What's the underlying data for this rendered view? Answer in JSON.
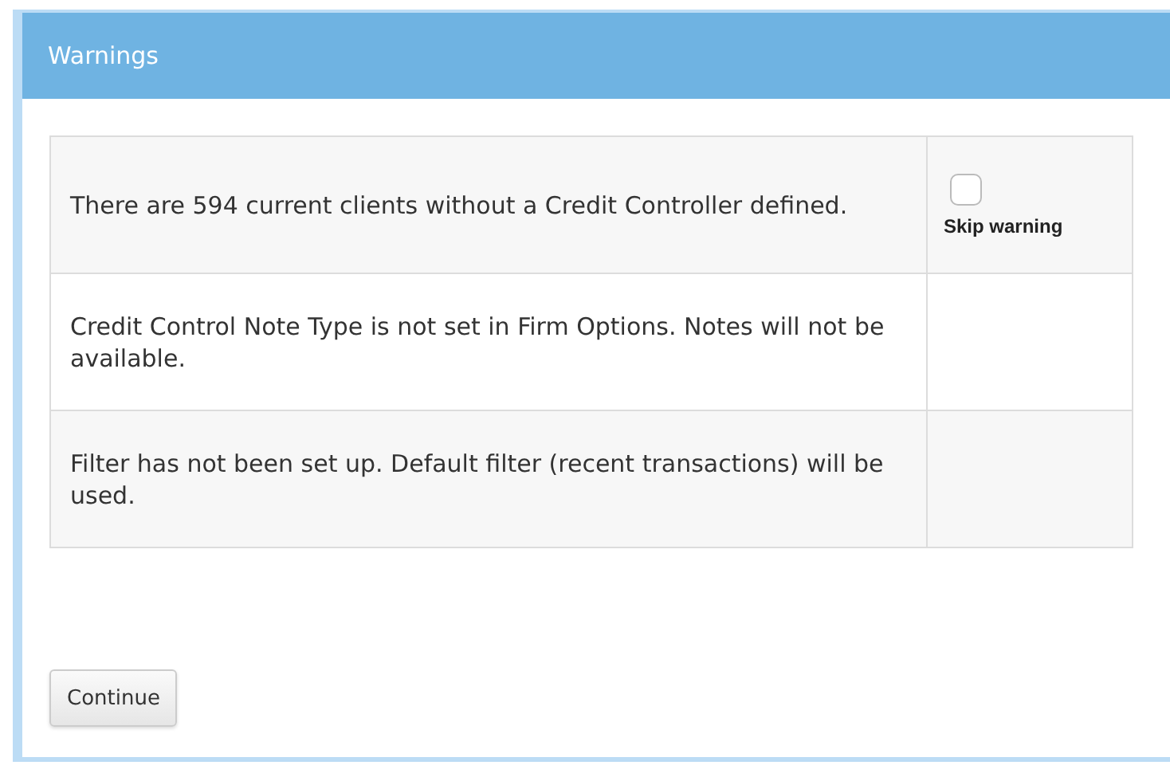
{
  "dialog": {
    "title": "Warnings"
  },
  "warnings": [
    {
      "message": "There are 594 current clients without a Credit Controller defined.",
      "skip": {
        "checked": false,
        "label": "Skip warning"
      }
    },
    {
      "message": "Credit Control Note Type is not set in Firm Options. Notes will not be available."
    },
    {
      "message": "Filter has not been set up. Default filter (recent transactions) will be used."
    }
  ],
  "buttons": [
    "Continue"
  ]
}
